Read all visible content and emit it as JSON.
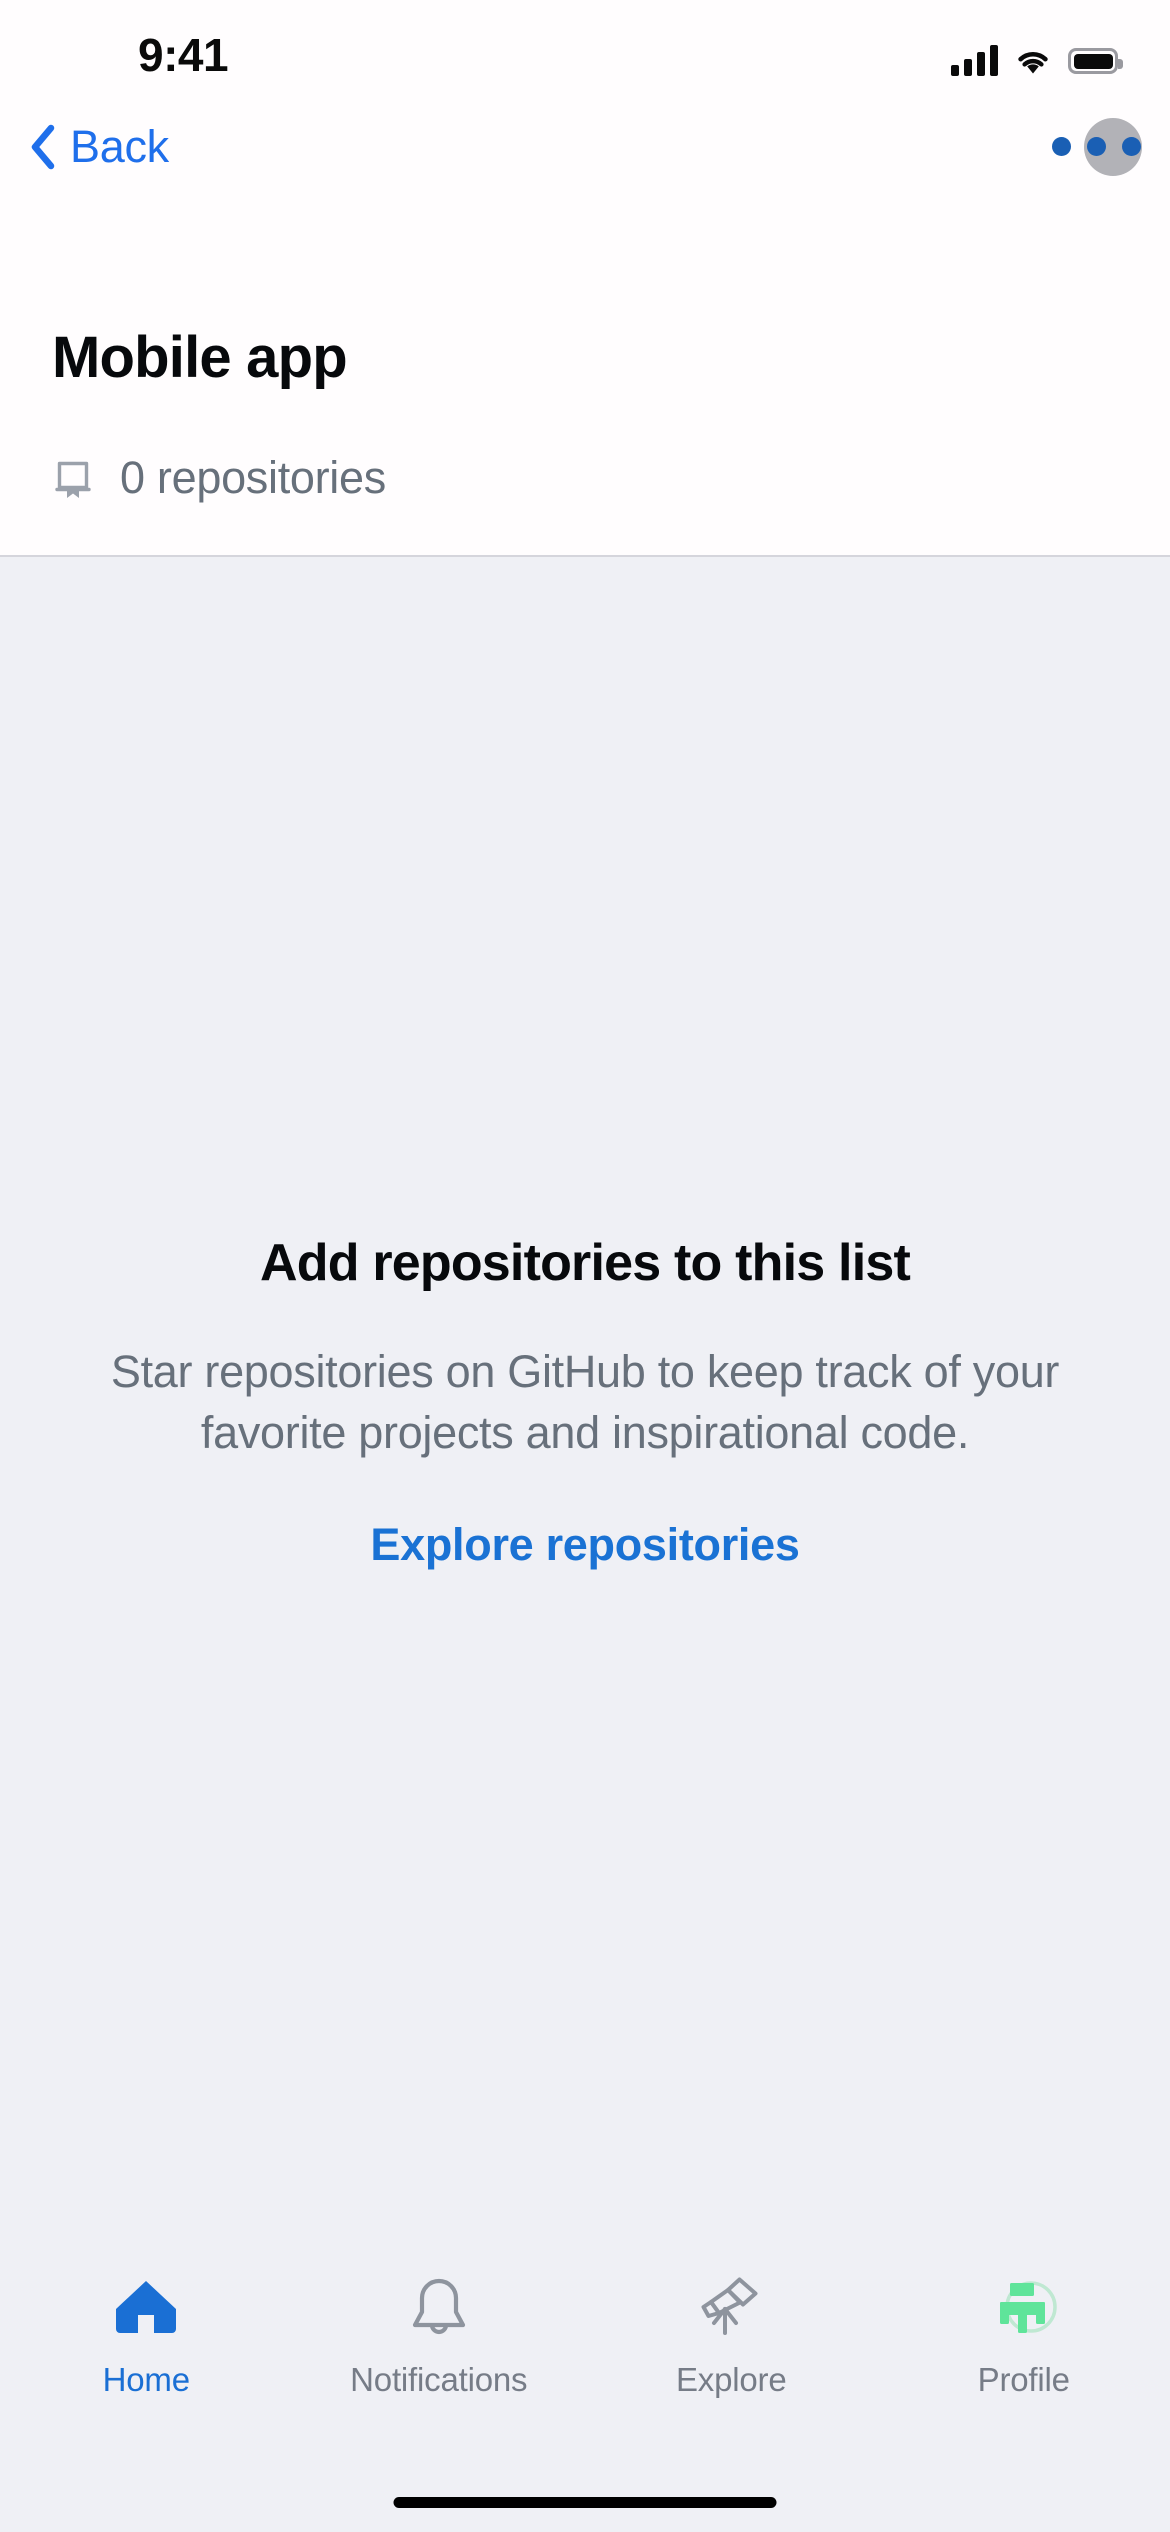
{
  "status_bar": {
    "time": "9:41",
    "icons": [
      "cellular-signal-icon",
      "wifi-icon",
      "battery-icon"
    ],
    "battery_level": 100
  },
  "nav_bar": {
    "back_label": "Back",
    "back_icon": "chevron-left-icon",
    "overflow_icon": "kebab-menu-icon",
    "avatar_icon": "user-avatar"
  },
  "header": {
    "title": "Mobile app",
    "repo_icon": "repo-icon",
    "repo_count_label": "0 repositories"
  },
  "empty_state": {
    "title": "Add repositories to this list",
    "description": "Star repositories on GitHub to keep track of your favorite projects and inspirational code.",
    "link_label": "Explore repositories"
  },
  "tab_bar": {
    "tabs": [
      {
        "label": "Home",
        "icon": "home-icon",
        "active": true
      },
      {
        "label": "Notifications",
        "icon": "bell-icon",
        "active": false
      },
      {
        "label": "Explore",
        "icon": "telescope-icon",
        "active": false
      },
      {
        "label": "Profile",
        "icon": "profile-avatar-icon",
        "active": false
      }
    ]
  },
  "colors": {
    "accent_blue": "#1f6feb",
    "link_blue": "#1a72d4",
    "background_gray": "#eff0f5",
    "surface_white": "#fffdfe",
    "muted_text": "#67707b",
    "profile_green": "#5fe49a"
  }
}
